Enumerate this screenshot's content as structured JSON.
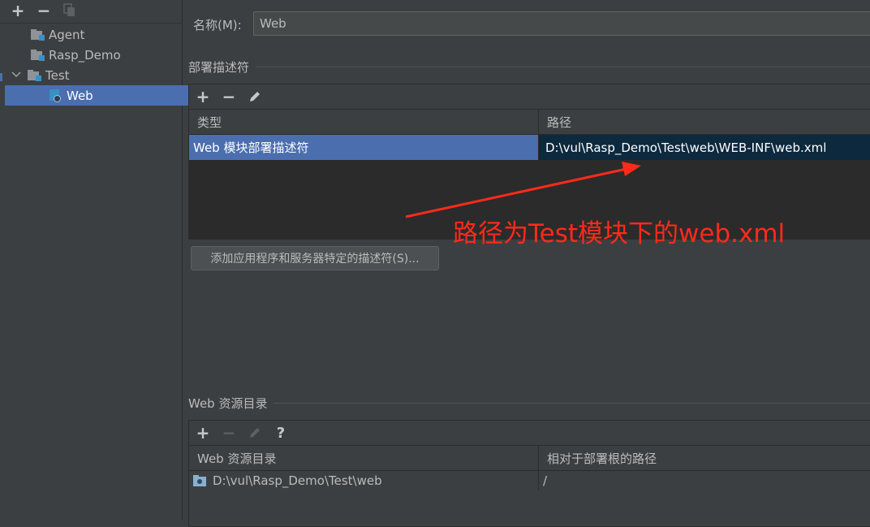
{
  "sidebar": {
    "toolbar": {
      "add": "+",
      "remove": "−"
    },
    "items": [
      {
        "label": "Agent"
      },
      {
        "label": "Rasp_Demo"
      },
      {
        "label": "Test"
      },
      {
        "label": "Web"
      }
    ]
  },
  "main": {
    "name_label": "名称(M):",
    "name_value": "Web",
    "descriptors_section": "部署描述符",
    "descriptor_toolbar": {
      "add": "+",
      "remove": "−"
    },
    "descriptor_columns": [
      "类型",
      "路径"
    ],
    "descriptor_rows": [
      {
        "type": "Web 模块部署描述符",
        "path": "D:\\vul\\Rasp_Demo\\Test\\web\\WEB-INF\\web.xml"
      }
    ],
    "add_descriptor_button": "添加应用程序和服务器特定的描述符(S)...",
    "web_resources_section": "Web 资源目录",
    "web_resources_toolbar": {
      "add": "+",
      "remove": "−",
      "help": "?"
    },
    "web_resources_columns": [
      "Web 资源目录",
      "相对于部署根的路径"
    ],
    "web_resources_rows": [
      {
        "dir": "D:\\vul\\Rasp_Demo\\Test\\web",
        "relative": "/"
      }
    ]
  },
  "annotation": {
    "text": "路径为Test模块下的web.xml",
    "color": "#ff2a1a"
  },
  "colors": {
    "selection": "#4b6eaf",
    "path_selection": "#0d293e",
    "background": "#3c3f41"
  }
}
